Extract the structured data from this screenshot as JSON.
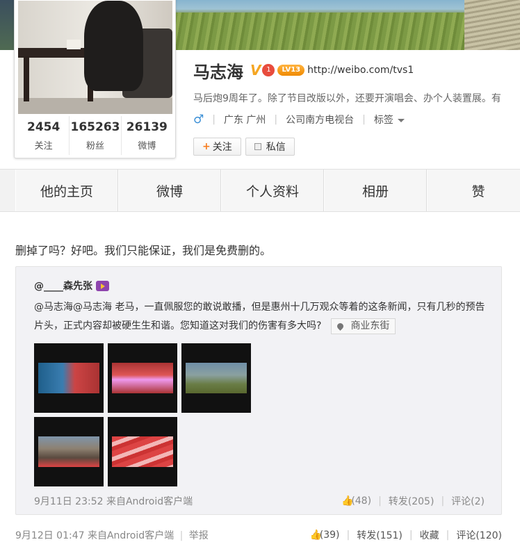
{
  "profile": {
    "name": "马志海",
    "v_badge": "V",
    "crown_badge": "1",
    "level_badge": "LV13",
    "url": "http://weibo.com/tvs1",
    "description": "马后炮9周年了。除了节目改版以外，还要开演唱会、办个人装置展。有",
    "gender_symbol": "♂",
    "location": "广东 广州",
    "company": "公司南方电视台",
    "tags_label": "标签",
    "follow_label": "关注",
    "message_label": "私信"
  },
  "stats": [
    {
      "num": "2454",
      "label": "关注"
    },
    {
      "num": "165263",
      "label": "粉丝"
    },
    {
      "num": "26139",
      "label": "微博"
    }
  ],
  "tabs": [
    "他的主页",
    "微博",
    "个人资料",
    "相册",
    "赞"
  ],
  "post": {
    "text": "删掉了吗？好吧。我们只能保证，我们是免费删的。",
    "time": "9月12日 01:47",
    "source": "来自Android客户端",
    "report": "举报",
    "likes": "(39)",
    "repost": "转发(151)",
    "favorite": "收藏",
    "comment": "评论(120)"
  },
  "repost": {
    "author": "@____森先张",
    "text": "@马志海@马志海 老马，一直佩服您的敢说敢播，但是惠州十几万观众等着的这条新闻，只有几秒的预告片头，正式内容却被硬生生和谐。您知道这对我们的伤害有多大吗?",
    "location": "商业东街",
    "time": "9月11日 23:52",
    "source": "来自Android客户端",
    "likes": "(48)",
    "repost": "转发(205)",
    "comment": "评论(2)"
  },
  "colors": {
    "accent": "#f77c1e",
    "link": "#3b8fd6",
    "repost_bg": "#f2f2f5"
  }
}
